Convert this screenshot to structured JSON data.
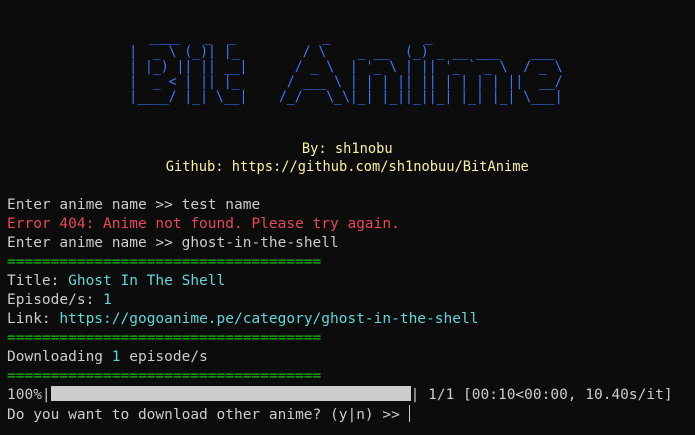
{
  "banner": {
    "art": " ____   _  _           _            _               \n|  _ \\ (_)| |_        / \\    _ __  (_) _ __ ___    ___ \n| |_) || || __|      / _ \\  | '_ \\ | || '_ ` _ \\  / _ \\\n|  _ < | || |_      / ___ \\ | | | || || | | | | ||  __/\n|____/ |_| \\__|    /_/   \\_\\|_| |_||_||_| |_| |_| \\___|",
    "author": "By: sh1nobu",
    "github": "Github: https://github.com/sh1nobuu/BitAnime"
  },
  "session": {
    "prompt_label": "Enter anime name >> ",
    "first_input": "test name",
    "error_message": "Error 404: Anime not found. Please try again.",
    "second_input": "ghost-in-the-shell",
    "separator": "====================================",
    "title_label": "Title: ",
    "title_value": "Ghost In The Shell",
    "episodes_label": "Episode/s: ",
    "episodes_value": "1",
    "link_label": "Link: ",
    "link_value": "https://gogoanime.pe/category/ghost-in-the-shell",
    "downloading_label": "Downloading ",
    "downloading_count": "1",
    "downloading_suffix": " episode/s",
    "progress_percent": "100%",
    "progress_fraction": 1.0,
    "progress_stats": " 1/1 [00:10<00:00, 10.40s/it]",
    "final_prompt": "Do you want to download other anime? (y|n) >> "
  },
  "colors": {
    "background": "#0c0c0c",
    "text": "#cccccc",
    "banner": "#3b78ff",
    "credit": "#f9f1a5",
    "error": "#e74856",
    "separator": "#16c60c",
    "value": "#61d6d6"
  }
}
